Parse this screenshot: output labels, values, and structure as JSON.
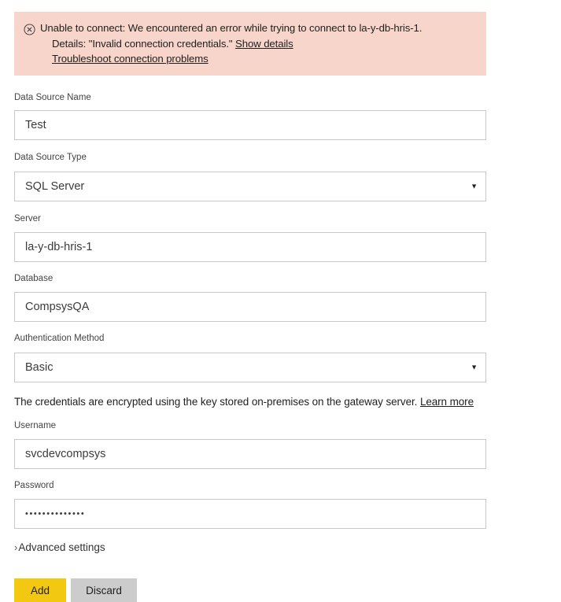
{
  "error_banner": {
    "icon": "error-circle-x-icon",
    "line1": "Unable to connect: We encountered an error while trying to connect to la-y-db-hris-1.",
    "line2_prefix": "Details: \"Invalid connection credentials.\" ",
    "line2_link": "Show details",
    "line3_link": "Troubleshoot connection problems",
    "background_color": "#f7d5ca"
  },
  "form": {
    "data_source_name": {
      "label": "Data Source Name",
      "value": "Test"
    },
    "data_source_type": {
      "label": "Data Source Type",
      "value": "SQL Server",
      "caret": "▼"
    },
    "server": {
      "label": "Server",
      "value": "la-y-db-hris-1"
    },
    "database": {
      "label": "Database",
      "value": "CompsysQA"
    },
    "authentication_method": {
      "label": "Authentication Method",
      "value": "Basic",
      "caret": "▼"
    },
    "credentials_note": {
      "text": "The credentials are encrypted using the key stored on-premises on the gateway server. ",
      "link": "Learn more"
    },
    "username": {
      "label": "Username",
      "value": "svcdevcompsys"
    },
    "password": {
      "label": "Password",
      "value": "••••••••••••••"
    }
  },
  "advanced_settings": {
    "chevron": "›",
    "label": "Advanced settings"
  },
  "buttons": {
    "add": "Add",
    "discard": "Discard",
    "add_color": "#f2c811",
    "discard_color": "#cccccc"
  }
}
